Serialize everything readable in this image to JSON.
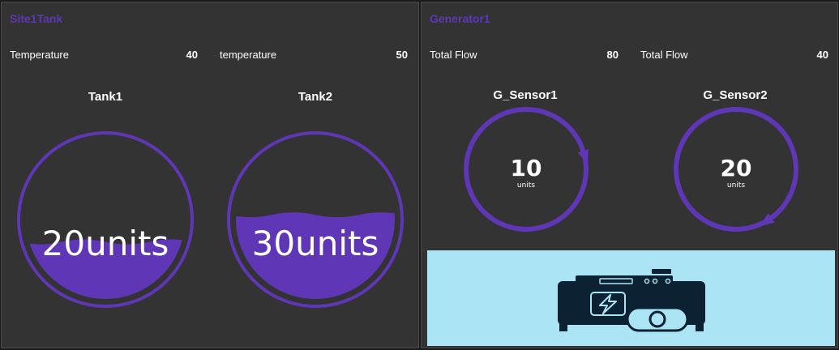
{
  "colors": {
    "accent": "#5f36b6",
    "panel_bg": "#333333",
    "image_bg": "#abe4f4",
    "icon_dark": "#0c2233"
  },
  "site_tank": {
    "title": "Site1Tank",
    "metrics": [
      {
        "label": "Temperature",
        "value": "40"
      },
      {
        "label": "temperature",
        "value": "50"
      }
    ],
    "tanks": [
      {
        "name": "Tank1",
        "display": "20units",
        "level": 0.36
      },
      {
        "name": "Tank2",
        "display": "30units",
        "level": 0.53
      }
    ]
  },
  "generator": {
    "title": "Generator1",
    "metrics": [
      {
        "label": "Total Flow",
        "value": "80"
      },
      {
        "label": "Total Flow",
        "value": "40"
      }
    ],
    "sensors": [
      {
        "name": "G_Sensor1",
        "value": "10",
        "unit": "units",
        "fraction": 0.2
      },
      {
        "name": "G_Sensor2",
        "value": "20",
        "unit": "units",
        "fraction": 0.4
      }
    ],
    "image_icon": "generator-icon"
  }
}
